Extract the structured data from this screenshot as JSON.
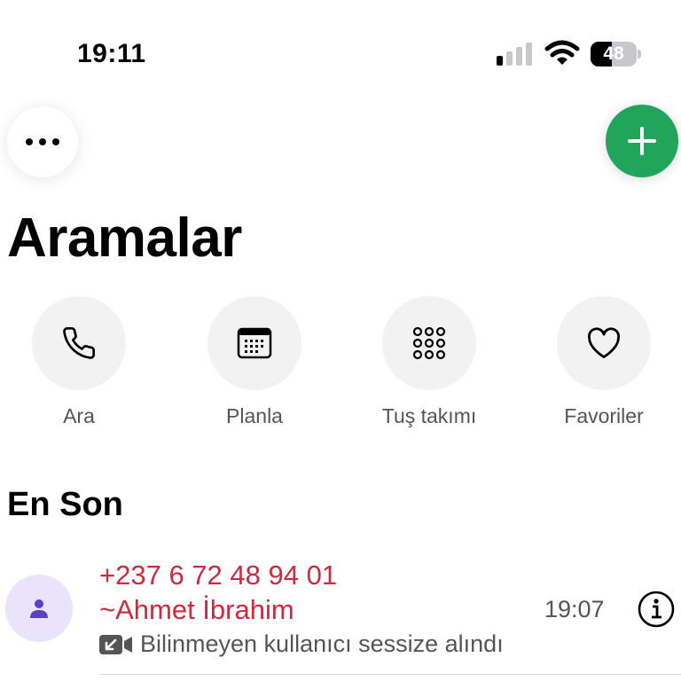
{
  "status_bar": {
    "time": "19:11",
    "battery": "48",
    "icons": [
      "signal-icon",
      "wifi-icon",
      "battery-icon"
    ]
  },
  "header": {
    "more_icon": "ellipsis-icon",
    "add_icon": "plus-icon",
    "add_color": "#21a55d",
    "title": "Aramalar"
  },
  "actions": [
    {
      "label": "Ara",
      "icon": "phone-icon"
    },
    {
      "label": "Planla",
      "icon": "calendar-icon"
    },
    {
      "label": "Tuş takımı",
      "icon": "keypad-icon"
    },
    {
      "label": "Favoriler",
      "icon": "heart-icon"
    }
  ],
  "recent": {
    "section_title": "En Son",
    "calls": [
      {
        "number": "+237 6 72 48 94 01",
        "name": "~Ahmet İbrahim",
        "status": "Bilinmeyen kullanıcı sessize alındı",
        "time": "19:07",
        "missed_color": "#cc2b3f",
        "type_icon": "incoming-video-call-icon",
        "avatar_icon": "person-icon"
      }
    ]
  }
}
